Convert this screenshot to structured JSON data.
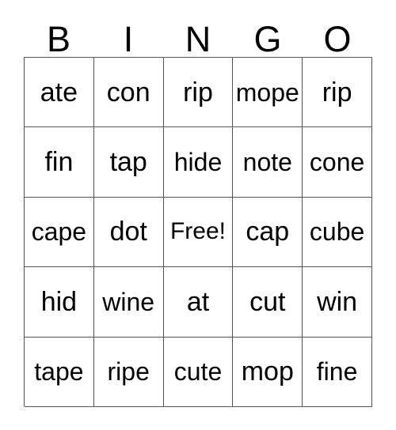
{
  "card": {
    "type": "bingo-card",
    "columns": 5,
    "rows": 5,
    "background_color": "#ffffff",
    "border_color": "#555555",
    "text_color": "#000000",
    "header": {
      "letters": [
        "B",
        "I",
        "N",
        "G",
        "O"
      ]
    },
    "free_space": {
      "label": "Free!",
      "row": 3,
      "column": 3
    },
    "grid": [
      [
        "ate",
        "con",
        "rip",
        "mope",
        "rip"
      ],
      [
        "fin",
        "tap",
        "hide",
        "note",
        "cone"
      ],
      [
        "cape",
        "dot",
        "Free!",
        "cap",
        "cube"
      ],
      [
        "hid",
        "wine",
        "at",
        "cut",
        "win"
      ],
      [
        "tape",
        "ripe",
        "cute",
        "mop",
        "fine"
      ]
    ]
  }
}
